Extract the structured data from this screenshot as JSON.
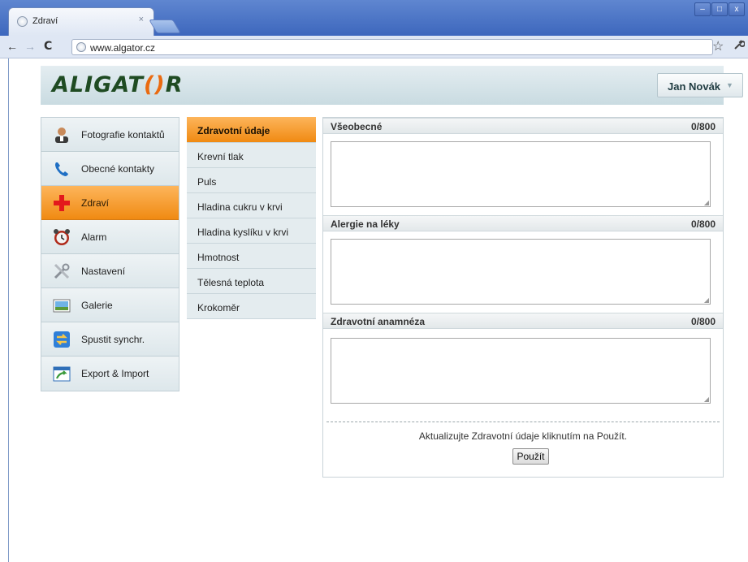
{
  "browser": {
    "tab_title": "Zdraví",
    "tab_close": "×",
    "url": "www.algator.cz",
    "back": "←",
    "forward": "→",
    "reload": "C",
    "star": "☆",
    "wrench": "🔧",
    "win_minimize": "–",
    "win_maximize": "□",
    "win_close": "x"
  },
  "header": {
    "logo_prefix": "ALIGAT",
    "logo_o": "()",
    "logo_suffix": "R",
    "user_name": "Jan Novák",
    "user_chevron": "▼"
  },
  "left_nav": [
    {
      "label": "Fotografie kontaktů",
      "icon": "contact-photo-icon"
    },
    {
      "label": "Obecné kontakty",
      "icon": "phone-icon"
    },
    {
      "label": "Zdraví",
      "icon": "red-cross-icon",
      "active": true
    },
    {
      "label": "Alarm",
      "icon": "alarm-clock-icon"
    },
    {
      "label": "Nastavení",
      "icon": "tools-icon"
    },
    {
      "label": "Galerie",
      "icon": "gallery-icon"
    },
    {
      "label": "Spustit synchr.",
      "icon": "sync-icon"
    },
    {
      "label": "Export & Import",
      "icon": "export-import-icon"
    }
  ],
  "sub_nav": [
    {
      "label": "Zdravotní údaje",
      "active": true
    },
    {
      "label": "Krevní tlak"
    },
    {
      "label": "Puls"
    },
    {
      "label": "Hladina cukru v krvi"
    },
    {
      "label": "Hladina kyslíku v krvi"
    },
    {
      "label": "Hmotnost"
    },
    {
      "label": "Tělesná teplota"
    },
    {
      "label": "Krokoměr"
    }
  ],
  "sections": [
    {
      "title": "Všeobecné",
      "count": "0/800",
      "value": ""
    },
    {
      "title": "Alergie na léky",
      "count": "0/800",
      "value": ""
    },
    {
      "title": "Zdravotní anamnéza",
      "count": "0/800",
      "value": ""
    }
  ],
  "footer": {
    "hint": "Aktualizujte Zdravotní údaje kliknutím na Použít.",
    "apply_label": "Použít"
  },
  "colors": {
    "accent_orange": "#f08a12",
    "logo_green": "#1f4b22",
    "header_bg": "#c9dbe1",
    "chrome_blue": "#4b70bf"
  }
}
